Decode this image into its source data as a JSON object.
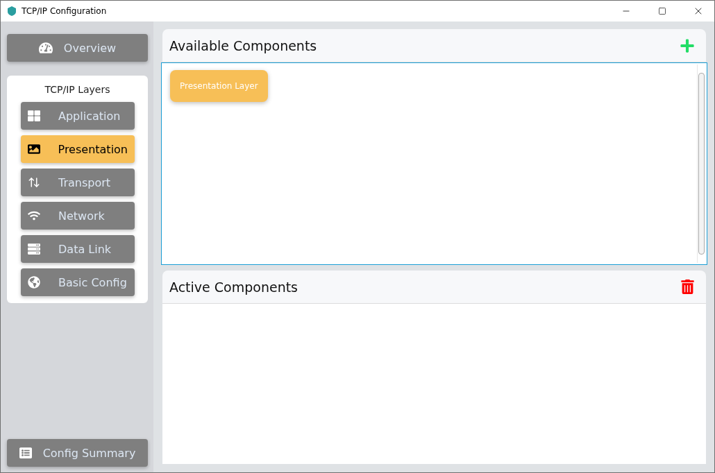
{
  "window": {
    "title": "TCP/IP Configuration"
  },
  "sidebar": {
    "overview": {
      "label": "Overview",
      "selected": false
    },
    "layers_title": "TCP/IP Layers",
    "items": [
      {
        "label": "Application",
        "selected": false
      },
      {
        "label": "Presentation",
        "selected": true
      },
      {
        "label": "Transport",
        "selected": false
      },
      {
        "label": "Network",
        "selected": false
      },
      {
        "label": "Data Link",
        "selected": false
      },
      {
        "label": "Basic Config",
        "selected": false
      }
    ],
    "summary": {
      "label": "Config Summary",
      "selected": false
    }
  },
  "available": {
    "title": "Available Components",
    "items": [
      "Presentation Layer"
    ]
  },
  "active": {
    "title": "Active Components"
  }
}
